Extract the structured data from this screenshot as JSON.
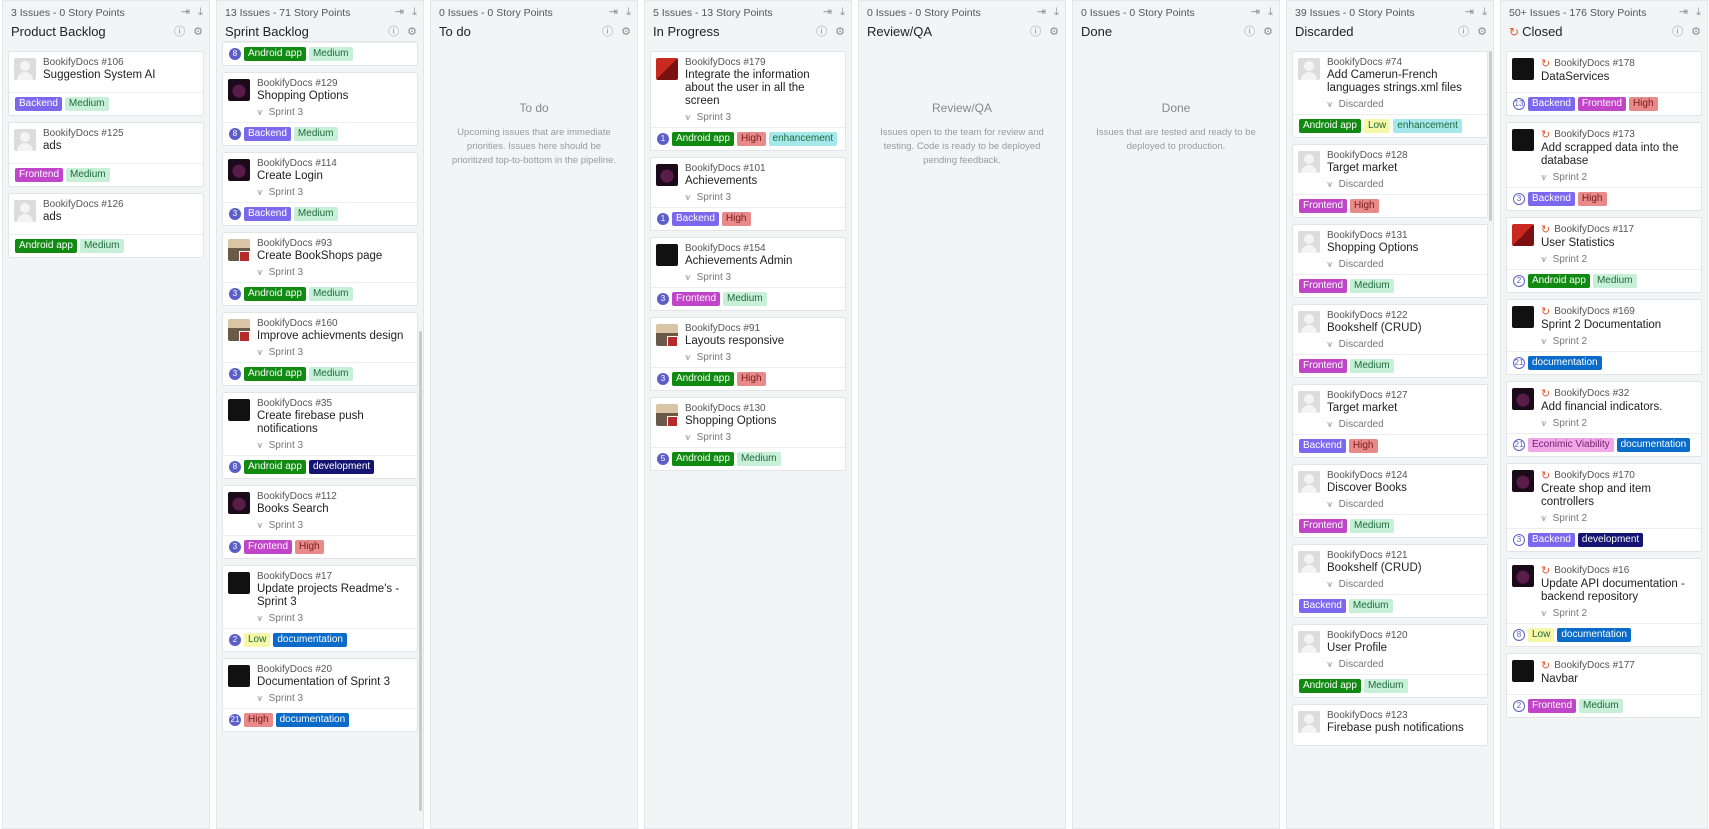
{
  "colors": {
    "Backend": "#7b68ee",
    "Frontend": "#c045c8",
    "Medium": "#c8f0d8",
    "High": "#e88a8a",
    "Low": "#f7f7a8",
    "Android app": "#118a11",
    "enhancement": "#a4e8ec",
    "development": "#141472",
    "documentation": "#0a6cc8",
    "Econimic Viability": "#f0a8e8"
  },
  "pipelines": [
    {
      "stats": "3 Issues - 0 Story Points",
      "title": "Product Backlog",
      "placeholder": null,
      "cards": [
        {
          "ref": "BookifyDocs #106",
          "title": "Suggestion System AI",
          "milestone": "",
          "avatar": "default",
          "estimate": "",
          "labels": [
            "Backend",
            "Medium"
          ]
        },
        {
          "ref": "BookifyDocs #125",
          "title": "ads",
          "milestone": "",
          "avatar": "default",
          "estimate": "",
          "labels": [
            "Frontend",
            "Medium"
          ]
        },
        {
          "ref": "BookifyDocs #126",
          "title": "ads",
          "milestone": "",
          "avatar": "default",
          "estimate": "",
          "labels": [
            "Android app",
            "Medium"
          ]
        }
      ]
    },
    {
      "stats": "13 Issues - 71 Story Points",
      "title": "Sprint Backlog",
      "placeholder": null,
      "shift": true,
      "cards": [
        {
          "ref": "",
          "title": "",
          "milestone": "",
          "avatar": "none",
          "estimate": "8",
          "labels": [
            "Android app",
            "Medium"
          ],
          "footOnly": true
        },
        {
          "ref": "BookifyDocs #129",
          "title": "Shopping Options",
          "milestone": "Sprint 3",
          "avatar": "purple",
          "estimate": "8",
          "labels": [
            "Backend",
            "Medium"
          ]
        },
        {
          "ref": "BookifyDocs #114",
          "title": "Create Login",
          "milestone": "Sprint 3",
          "avatar": "purple",
          "estimate": "3",
          "labels": [
            "Backend",
            "Medium"
          ]
        },
        {
          "ref": "BookifyDocs #93",
          "title": "Create BookShops page",
          "milestone": "Sprint 3",
          "avatar": "photo",
          "estimate": "3",
          "labels": [
            "Android app",
            "Medium"
          ]
        },
        {
          "ref": "BookifyDocs #160",
          "title": "Improve achievments design",
          "milestone": "Sprint 3",
          "avatar": "photo",
          "estimate": "3",
          "labels": [
            "Android app",
            "Medium"
          ]
        },
        {
          "ref": "BookifyDocs #35",
          "title": "Create firebase push notifications",
          "milestone": "Sprint 3",
          "avatar": "dark",
          "estimate": "8",
          "labels": [
            "Android app",
            "development"
          ]
        },
        {
          "ref": "BookifyDocs #112",
          "title": "Books Search",
          "milestone": "Sprint 3",
          "avatar": "purple",
          "estimate": "3",
          "labels": [
            "Frontend",
            "High"
          ]
        },
        {
          "ref": "BookifyDocs #17",
          "title": "Update projects Readme's - Sprint 3",
          "milestone": "Sprint 3",
          "avatar": "dark",
          "estimate": "2",
          "labels": [
            "Low",
            "documentation"
          ]
        },
        {
          "ref": "BookifyDocs #20",
          "title": "Documentation of Sprint 3",
          "milestone": "Sprint 3",
          "avatar": "dark",
          "estimate": "21",
          "labels": [
            "High",
            "documentation"
          ]
        }
      ]
    },
    {
      "stats": "0 Issues - 0 Story Points",
      "title": "To do",
      "placeholder": {
        "title": "To do",
        "text": "Upcoming issues that are immediate priorities. Issues here should be prioritized top-to-bottom in the pipeline."
      },
      "cards": []
    },
    {
      "stats": "5 Issues - 13 Story Points",
      "title": "In Progress",
      "placeholder": null,
      "cards": [
        {
          "ref": "BookifyDocs #179",
          "title": "Integrate the information about the user in all the screen",
          "milestone": "Sprint 3",
          "avatar": "red",
          "estimate": "1",
          "labels": [
            "Android app",
            "High",
            "enhancement"
          ]
        },
        {
          "ref": "BookifyDocs #101",
          "title": "Achievements",
          "milestone": "Sprint 3",
          "avatar": "purple",
          "estimate": "1",
          "labels": [
            "Backend",
            "High"
          ]
        },
        {
          "ref": "BookifyDocs #154",
          "title": "Achievements Admin",
          "milestone": "Sprint 3",
          "avatar": "dark",
          "estimate": "3",
          "labels": [
            "Frontend",
            "Medium"
          ]
        },
        {
          "ref": "BookifyDocs #91",
          "title": "Layouts responsive",
          "milestone": "Sprint 3",
          "avatar": "photo",
          "estimate": "3",
          "labels": [
            "Android app",
            "High"
          ]
        },
        {
          "ref": "BookifyDocs #130",
          "title": "Shopping Options",
          "milestone": "Sprint 3",
          "avatar": "photo",
          "estimate": "5",
          "labels": [
            "Android app",
            "Medium"
          ]
        }
      ]
    },
    {
      "stats": "0 Issues - 0 Story Points",
      "title": "Review/QA",
      "placeholder": {
        "title": "Review/QA",
        "text": "Issues open to the team for review and testing. Code is ready to be deployed pending feedback."
      },
      "cards": []
    },
    {
      "stats": "0 Issues - 0 Story Points",
      "title": "Done",
      "placeholder": {
        "title": "Done",
        "text": "Issues that are tested and ready to be deployed to production."
      },
      "cards": []
    },
    {
      "stats": "39 Issues - 0 Story Points",
      "title": "Discarded",
      "placeholder": null,
      "cards": [
        {
          "ref": "BookifyDocs #74",
          "title": "Add Camerun-French languages strings.xml files",
          "milestone": "Discarded",
          "avatar": "default",
          "estimate": "",
          "labels": [
            "Android app",
            "Low",
            "enhancement"
          ]
        },
        {
          "ref": "BookifyDocs #128",
          "title": "Target market",
          "milestone": "Discarded",
          "avatar": "default",
          "estimate": "",
          "labels": [
            "Frontend",
            "High"
          ]
        },
        {
          "ref": "BookifyDocs #131",
          "title": "Shopping Options",
          "milestone": "Discarded",
          "avatar": "default",
          "estimate": "",
          "labels": [
            "Frontend",
            "Medium"
          ]
        },
        {
          "ref": "BookifyDocs #122",
          "title": "Bookshelf (CRUD)",
          "milestone": "Discarded",
          "avatar": "default",
          "estimate": "",
          "labels": [
            "Frontend",
            "Medium"
          ]
        },
        {
          "ref": "BookifyDocs #127",
          "title": "Target market",
          "milestone": "Discarded",
          "avatar": "default",
          "estimate": "",
          "labels": [
            "Backend",
            "High"
          ]
        },
        {
          "ref": "BookifyDocs #124",
          "title": "Discover Books",
          "milestone": "Discarded",
          "avatar": "default",
          "estimate": "",
          "labels": [
            "Frontend",
            "Medium"
          ]
        },
        {
          "ref": "BookifyDocs #121",
          "title": "Bookshelf (CRUD)",
          "milestone": "Discarded",
          "avatar": "default",
          "estimate": "",
          "labels": [
            "Backend",
            "Medium"
          ]
        },
        {
          "ref": "BookifyDocs #120",
          "title": "User Profile",
          "milestone": "Discarded",
          "avatar": "default",
          "estimate": "",
          "labels": [
            "Android app",
            "Medium"
          ]
        },
        {
          "ref": "BookifyDocs #123",
          "title": "Firebase push notifications",
          "milestone": "",
          "avatar": "default",
          "estimate": "",
          "labels": []
        }
      ]
    },
    {
      "stats": "50+ Issues - 176 Story Points",
      "title": "Closed",
      "closed": true,
      "placeholder": null,
      "cards": [
        {
          "ref": "BookifyDocs #178",
          "title": "DataServices",
          "milestone": "",
          "avatar": "dark",
          "estimate": "13",
          "labels": [
            "Backend",
            "Frontend",
            "High"
          ],
          "closedRef": true
        },
        {
          "ref": "BookifyDocs #173",
          "title": "Add scrapped data into the database",
          "milestone": "Sprint 2",
          "avatar": "dark",
          "estimate": "3",
          "labels": [
            "Backend",
            "High"
          ],
          "closedRef": true
        },
        {
          "ref": "BookifyDocs #117",
          "title": "User Statistics",
          "milestone": "Sprint 2",
          "avatar": "red",
          "estimate": "2",
          "labels": [
            "Android app",
            "Medium"
          ],
          "closedRef": true
        },
        {
          "ref": "BookifyDocs #169",
          "title": "Sprint 2 Documentation",
          "milestone": "Sprint 2",
          "avatar": "dark",
          "estimate": "21",
          "labels": [
            "documentation"
          ],
          "closedRef": true
        },
        {
          "ref": "BookifyDocs #32",
          "title": "Add financial indicators.",
          "milestone": "Sprint 2",
          "avatar": "purple",
          "estimate": "21",
          "labels": [
            "Econimic Viability",
            "documentation"
          ],
          "closedRef": true
        },
        {
          "ref": "BookifyDocs #170",
          "title": "Create shop and item controllers",
          "milestone": "Sprint 2",
          "avatar": "purple",
          "estimate": "3",
          "labels": [
            "Backend",
            "development"
          ],
          "closedRef": true
        },
        {
          "ref": "BookifyDocs #16",
          "title": "Update API documentation - backend repository",
          "milestone": "Sprint 2",
          "avatar": "purple",
          "estimate": "8",
          "labels": [
            "Low",
            "documentation"
          ],
          "closedRef": true
        },
        {
          "ref": "BookifyDocs #177",
          "title": "Navbar",
          "milestone": "",
          "avatar": "dark",
          "estimate": "2",
          "labels": [
            "Frontend",
            "Medium"
          ],
          "closedRef": true
        }
      ]
    }
  ]
}
